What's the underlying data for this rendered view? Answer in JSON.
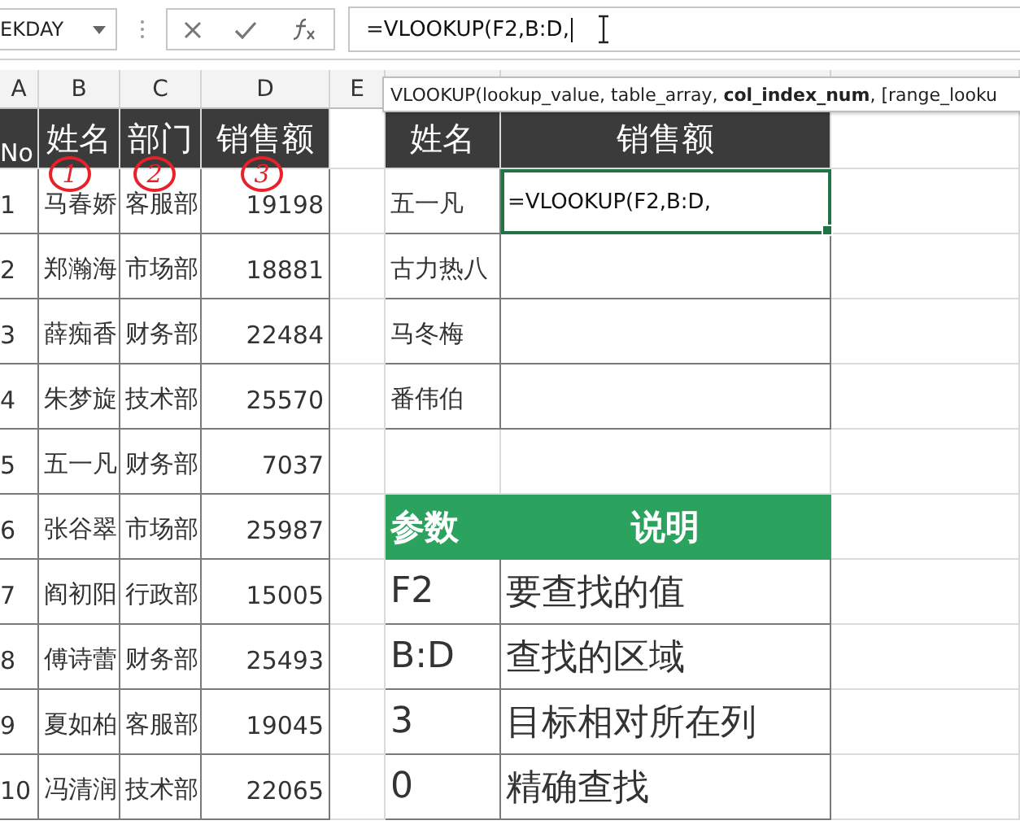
{
  "formula_bar": {
    "name_box": "EKDAY",
    "formula": "=VLOOKUP(F2,B:D,"
  },
  "tooltip": "VLOOKUP(lookup_value, table_array, **col_index_num**, [range_looku",
  "column_headers": [
    "A",
    "B",
    "C",
    "D",
    "E"
  ],
  "main_table": {
    "headers": [
      "No",
      "姓名",
      "部门",
      "销售额"
    ],
    "rows": [
      [
        "1",
        "马春娇",
        "客服部",
        "19198"
      ],
      [
        "2",
        "郑瀚海",
        "市场部",
        "18881"
      ],
      [
        "3",
        "薛痴香",
        "财务部",
        "22484"
      ],
      [
        "4",
        "朱梦旋",
        "技术部",
        "25570"
      ],
      [
        "5",
        "五一凡",
        "财务部",
        "7037"
      ],
      [
        "6",
        "张谷翠",
        "市场部",
        "25987"
      ],
      [
        "7",
        "阎初阳",
        "行政部",
        "15005"
      ],
      [
        "8",
        "傅诗蕾",
        "财务部",
        "25493"
      ],
      [
        "9",
        "夏如柏",
        "客服部",
        "19045"
      ],
      [
        "10",
        "冯清润",
        "技术部",
        "22065"
      ]
    ]
  },
  "annotations": [
    "1",
    "2",
    "3"
  ],
  "lookup_table": {
    "headers": [
      "姓名",
      "销售额"
    ],
    "names": [
      "五一凡",
      "古力热八",
      "马冬梅",
      "番伟伯"
    ],
    "active_cell": "=VLOOKUP(F2,B:D,"
  },
  "param_table": {
    "headers": [
      "参数",
      "说明"
    ],
    "rows": [
      [
        "F2",
        "要查找的值"
      ],
      [
        "B:D",
        "查找的区域"
      ],
      [
        "3",
        "目标相对所在列"
      ],
      [
        "0",
        "精确查找"
      ]
    ]
  }
}
